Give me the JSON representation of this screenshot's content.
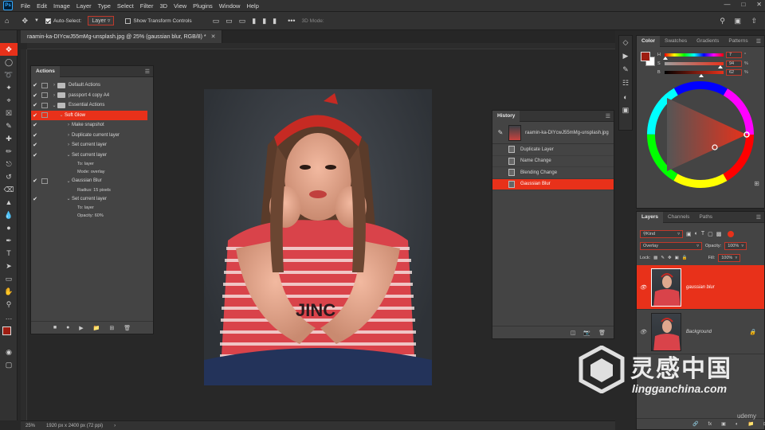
{
  "app": {
    "logo": "Ps",
    "menus": [
      "File",
      "Edit",
      "Image",
      "Layer",
      "Type",
      "Select",
      "Filter",
      "3D",
      "View",
      "Plugins",
      "Window",
      "Help"
    ]
  },
  "options_bar": {
    "auto_select_label": "Auto-Select:",
    "auto_select_target": "Layer",
    "show_transform_label": "Show Transform Controls",
    "mode_3d": "3D Mode:"
  },
  "document": {
    "tab_title": "raamin-ka-DIYcwJ55mMg-unsplash.jpg @ 25% (gaussian blur, RGB/8) *",
    "zoom": "25%",
    "size": "1920 px x 2400 px (72 ppi)"
  },
  "actions_panel": {
    "title": "Actions",
    "rows": [
      {
        "indent": 0,
        "type": "set",
        "check": true,
        "dialog": true,
        "label": "Default Actions"
      },
      {
        "indent": 0,
        "type": "set",
        "check": true,
        "dialog": true,
        "label": "passport 4 copy A4"
      },
      {
        "indent": 0,
        "type": "set-open",
        "check": true,
        "dialog": true,
        "label": "Essential Actions"
      },
      {
        "indent": 1,
        "type": "action-open",
        "check": true,
        "dialog": true,
        "label": "Soft Glow",
        "selected": true
      },
      {
        "indent": 2,
        "type": "step",
        "check": true,
        "dialog": false,
        "label": "Make snapshot"
      },
      {
        "indent": 2,
        "type": "step",
        "check": true,
        "dialog": false,
        "label": "Duplicate current layer"
      },
      {
        "indent": 2,
        "type": "step",
        "check": true,
        "dialog": false,
        "label": "Set current layer"
      },
      {
        "indent": 2,
        "type": "step-open",
        "check": true,
        "dialog": false,
        "label": "Set current layer",
        "sub": [
          "To: layer",
          "Mode: overlay"
        ]
      },
      {
        "indent": 2,
        "type": "step-open",
        "check": true,
        "dialog": true,
        "label": "Gaussian Blur",
        "sub": [
          "Radius: 15 pixels"
        ]
      },
      {
        "indent": 2,
        "type": "step-open",
        "check": true,
        "dialog": false,
        "label": "Set current layer",
        "sub": [
          "To: layer",
          "Opacity: 60%"
        ]
      }
    ]
  },
  "history_panel": {
    "title": "History",
    "snapshot": "raamin-ka-DIYcwJ55mMg-unsplash.jpg",
    "states": [
      {
        "label": "Duplicate Layer"
      },
      {
        "label": "Name Change"
      },
      {
        "label": "Blending Change"
      },
      {
        "label": "Gaussian Blur",
        "selected": true
      }
    ]
  },
  "color_panel": {
    "tabs": [
      "Color",
      "Swatches",
      "Gradients",
      "Patterns"
    ],
    "sliders": [
      {
        "label": "H",
        "value": "7",
        "unit": "°"
      },
      {
        "label": "S",
        "value": "94",
        "unit": "%"
      },
      {
        "label": "B",
        "value": "62",
        "unit": "%"
      }
    ],
    "fg_color": "#9e1d12",
    "bg_color": "#ffffff"
  },
  "layers_panel": {
    "tabs": [
      "Layers",
      "Channels",
      "Paths"
    ],
    "filter_kind": "Kind",
    "blend_mode": "Overlay",
    "opacity_label": "Opacity:",
    "opacity": "100%",
    "lock_label": "Lock:",
    "fill_label": "Fill:",
    "fill": "100%",
    "layers": [
      {
        "name": "gaussian blur",
        "selected": true
      },
      {
        "name": "Background",
        "selected": false
      }
    ]
  },
  "watermark": {
    "cn_text": "灵感中国",
    "url": "lingganchina.com",
    "udemy": "udemy"
  },
  "colors": {
    "accent": "#e8311a"
  }
}
